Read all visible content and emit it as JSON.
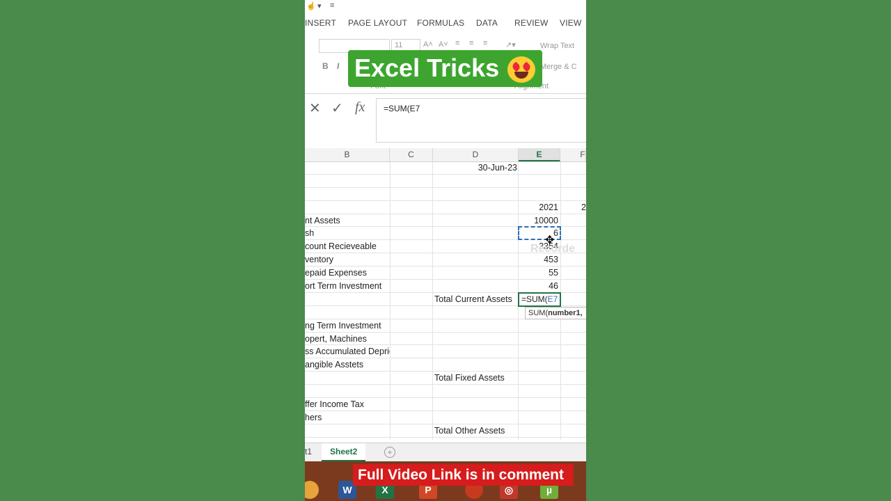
{
  "ribbon": {
    "tabs": [
      "INSERT",
      "PAGE LAYOUT",
      "FORMULAS",
      "DATA",
      "REVIEW",
      "VIEW"
    ],
    "font_size": "11",
    "wrap_text": "Wrap Text",
    "merge": "Merge & C",
    "font_group": "Font",
    "alignment_group": "Alignment",
    "bold": "B",
    "italic": "I"
  },
  "formula_bar": {
    "cancel_icon": "x-icon",
    "enter_icon": "check-icon",
    "fx_label": "fx",
    "formula": "=SUM(E7"
  },
  "grid": {
    "columns": [
      "B",
      "C",
      "D",
      "E",
      "F"
    ],
    "active_column": "E",
    "date": "30-Jun-23",
    "year_e": "2021",
    "year_f": "2",
    "rows": [
      {
        "b": "nt Assets",
        "d": "",
        "e": "10000"
      },
      {
        "b": "sh",
        "d": "",
        "e": "6"
      },
      {
        "b": "count Recieveable",
        "d": "",
        "e": "3354"
      },
      {
        "b": "ventory",
        "d": "",
        "e": "453"
      },
      {
        "b": "epaid Expenses",
        "d": "",
        "e": "55"
      },
      {
        "b": "ort Term Investment",
        "d": "",
        "e": "46"
      },
      {
        "b": "",
        "d": "Total Current Assets",
        "e": ""
      },
      {
        "b": "",
        "d": "",
        "e": ""
      },
      {
        "b": "ng Term Investment",
        "d": "",
        "e": ""
      },
      {
        "b": "opert, Machines",
        "d": "",
        "e": ""
      },
      {
        "b": "ss Accumulated Depriciacion",
        "d": "",
        "e": ""
      },
      {
        "b": "angible Asstets",
        "d": "",
        "e": ""
      },
      {
        "b": "",
        "d": "Total Fixed Assets",
        "e": ""
      },
      {
        "b": "",
        "d": "",
        "e": ""
      },
      {
        "b": "ffer Income Tax",
        "d": "",
        "e": ""
      },
      {
        "b": "hers",
        "d": "",
        "e": ""
      },
      {
        "b": "",
        "d": "Total Other Assets",
        "e": ""
      }
    ],
    "edit_prefix": "=SUM(",
    "edit_ref": "E7",
    "tooltip_fn": "SUM(",
    "tooltip_arg": "number1,",
    "recorder_watermark": "Recorde"
  },
  "sheets": {
    "tab1": "t1",
    "tab2": "Sheet2",
    "add": "+"
  },
  "overlay": {
    "title": "Excel Tricks",
    "footer": "Full Video Link is in comment"
  },
  "colors": {
    "background": "#4a8a4b",
    "excel_green": "#217346",
    "title_badge": "#3da52f",
    "footer_badge": "#d61c1c"
  }
}
